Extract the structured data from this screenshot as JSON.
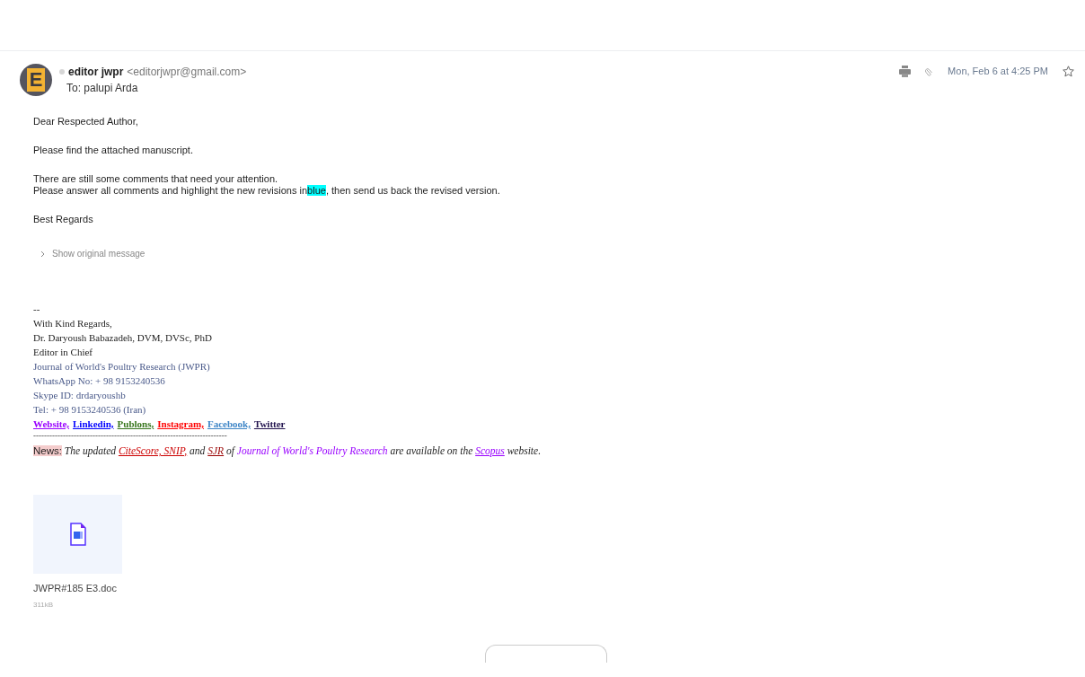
{
  "message": {
    "sender_name": "editor jwpr",
    "sender_email": "<editorjwpr@gmail.com>",
    "avatar_letter": "E",
    "to": "To: palupi Arda",
    "date": "Mon, Feb 6 at 4:25 PM",
    "starred": false
  },
  "body": [
    [
      {
        "kind": "plain",
        "text": "Dear Respected Author,"
      }
    ],
    [
      {
        "kind": "plain",
        "text": "Please find the attached manuscript."
      }
    ],
    [
      {
        "kind": "plain",
        "text": "There are still some comments that need your attention."
      }
    ],
    [
      {
        "kind": "plain",
        "text": "Please answer all comments and highlight the new revisions in"
      },
      {
        "kind": "highlight",
        "text": "blue"
      },
      {
        "kind": "plain",
        "text": ", then send us back the revised version."
      }
    ],
    [
      {
        "kind": "plain",
        "text": "Best Regards"
      }
    ]
  ],
  "show_original": "Show original message",
  "signature": [
    {
      "kind": "plain",
      "text": "--"
    },
    {
      "kind": "plain",
      "text": "With Kind Regards,"
    },
    {
      "kind": "plain",
      "text": "Dr. Daryoush Babazadeh, DVM, DVSc, PhD"
    },
    {
      "kind": "plain",
      "text": "Editor in Chief"
    },
    {
      "kind": "muted",
      "text": "Journal of World's Poultry Research (JWPR)"
    },
    {
      "kind": "muted",
      "text": "WhatsApp No: + 98 9153240536"
    },
    {
      "kind": "muted",
      "text": "Skype ID: drdaryoushb"
    },
    {
      "kind": "muted",
      "text": "Tel: + 98 9153240536 (Iran)"
    }
  ],
  "social_links": [
    {
      "label": "Website,",
      "color": "#9900ff"
    },
    {
      "label": "Linkedin,",
      "color": "#0000ff"
    },
    {
      "label": "Publons,",
      "color": "#38761d"
    },
    {
      "label": "Instagram,",
      "color": "#ff0000"
    },
    {
      "label": "Facebook,",
      "color": "#3d85c6"
    },
    {
      "label": "Twitter",
      "color": "#20124d"
    }
  ],
  "rule": "------------------------------------------------------------------------",
  "news": [
    {
      "kind": "tag",
      "text": "News:"
    },
    {
      "kind": "plain",
      "text": " The updated "
    },
    {
      "kind": "link",
      "text": "CiteScore, SNIP,",
      "color": "#cc0000"
    },
    {
      "kind": "plain",
      "text": " and "
    },
    {
      "kind": "link",
      "text": "SJR",
      "color": "#990000"
    },
    {
      "kind": "plain",
      "text": " of "
    },
    {
      "kind": "accent",
      "text": "Journal of World's Poultry Research"
    },
    {
      "kind": "plain",
      "text": " are available on the "
    },
    {
      "kind": "link",
      "text": "Scopus",
      "color": "#9900ff"
    },
    {
      "kind": "plain",
      "text": " website."
    }
  ],
  "attachment": {
    "name": "JWPR#185 E3.doc",
    "size": "311kB"
  }
}
